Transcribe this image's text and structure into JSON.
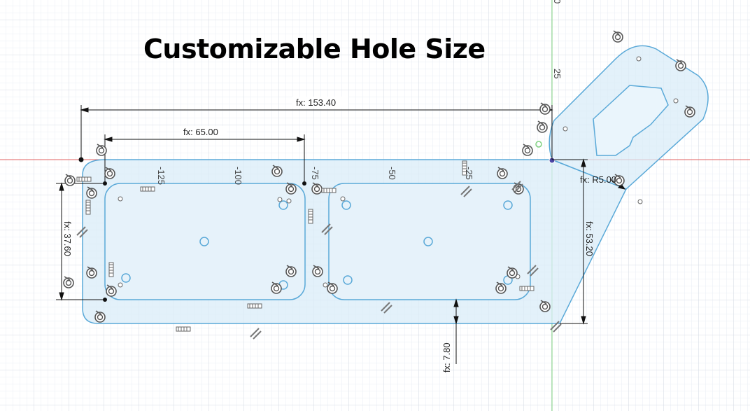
{
  "banner": {
    "title": "Customizable Hole Size"
  },
  "axes": {
    "tick_labels": [
      "-125",
      "-100",
      "-75",
      "-50",
      "-25",
      "25",
      "0"
    ],
    "red_axis_color": "#e06060",
    "green_axis_color": "#7fd17f"
  },
  "dimensions": {
    "overall_width": "fx: 153.40",
    "slot_width": "fx: 65.00",
    "slot_height": "fx: 37.60",
    "overall_height": "fx: 53.20",
    "bottom_margin": "fx: 7.80",
    "fillet_radius": "fx: R5.00"
  },
  "colors": {
    "sketch_fill": "#d9ecf8",
    "sketch_line": "#5aa9d8",
    "dimension_line": "#111111",
    "grid_minor": "#e9eef4",
    "grid_major": "#d3dae3"
  },
  "icons": [
    "coincident-constraint-icon",
    "horizontal-constraint-icon",
    "vertical-constraint-icon",
    "parallel-constraint-icon",
    "tangent-constraint-icon"
  ]
}
